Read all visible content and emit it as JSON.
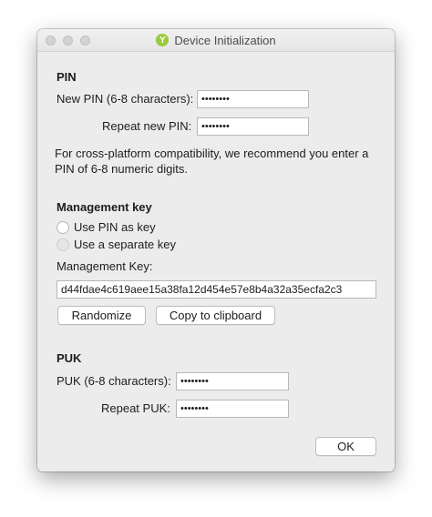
{
  "window": {
    "title": "Device Initialization",
    "app_icon_glyph": "Y"
  },
  "pin": {
    "heading": "PIN",
    "new_label": "New PIN (6-8 characters):",
    "new_value": "••••••••",
    "repeat_label": "Repeat new PIN:",
    "repeat_value": "••••••••",
    "note": "For cross-platform compatibility, we recommend you enter a PIN of 6-8 numeric digits."
  },
  "management": {
    "heading": "Management key",
    "radio_use_pin": "Use PIN as key",
    "radio_separate": "Use a separate key",
    "key_label": "Management Key:",
    "key_value": "d44fdae4c619aee15a38fa12d454e57e8b4a32a35ecfa2c3",
    "randomize_label": "Randomize",
    "copy_label": "Copy to clipboard"
  },
  "puk": {
    "heading": "PUK",
    "puk_label": "PUK (6-8 characters):",
    "puk_value": "••••••••",
    "repeat_label": "Repeat PUK:",
    "repeat_value": "••••••••"
  },
  "ok_label": "OK"
}
